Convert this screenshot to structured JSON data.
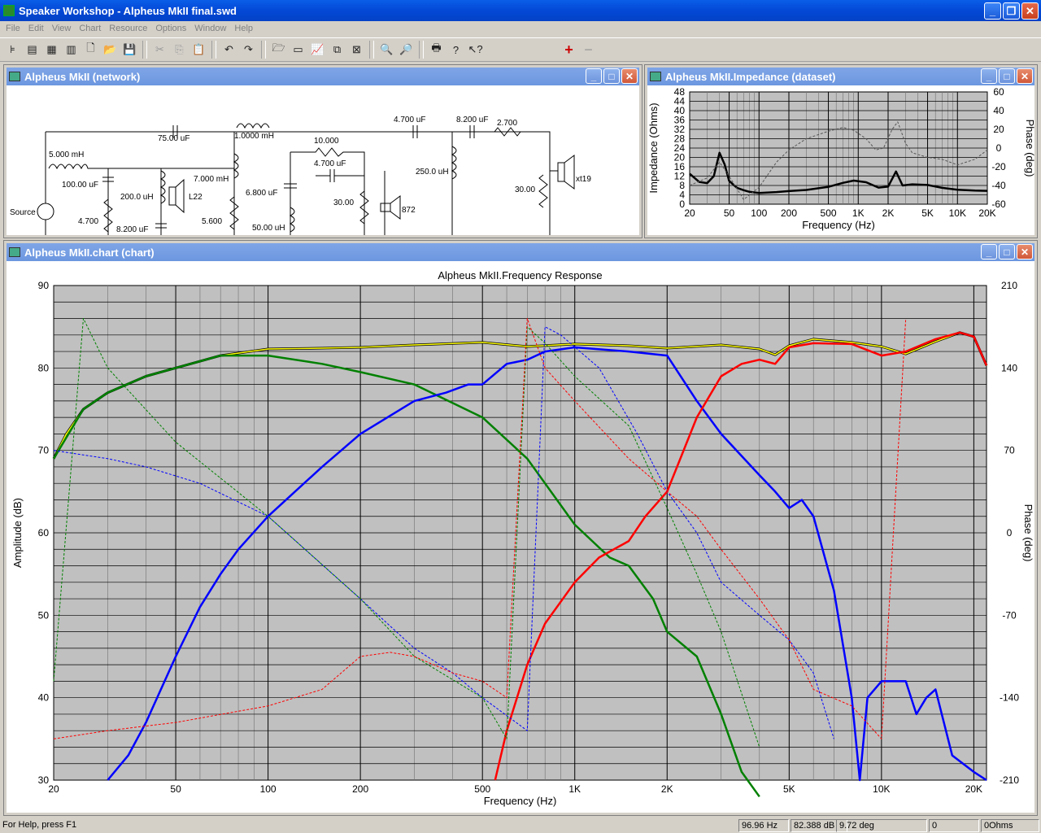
{
  "app": {
    "title": "Speaker Workshop - Alpheus MkII final.swd"
  },
  "menu": [
    "File",
    "Edit",
    "View",
    "Chart",
    "Resource",
    "Options",
    "Window",
    "Help"
  ],
  "network_window": {
    "title": "Alpheus MkII (network)",
    "labels": {
      "source": "Source",
      "l1": "5.000 mH",
      "c1": "100.00 uF",
      "r1": "4.700",
      "c2": "75.00 uF",
      "l2": "200.0 uH",
      "c3": "8.200 uF",
      "drv1": "L22",
      "l3": "1.0000 mH",
      "l4": "7.000 mH",
      "r2": "5.600",
      "r3": "10.000",
      "c4": "4.700 uF",
      "c5": "6.800 uF",
      "l5": "50.00 uH",
      "r4": "30.00",
      "drv2": "872",
      "c6": "4.700 uF",
      "c7": "8.200 uF",
      "r5": "2.700",
      "l6": "250.0 uH",
      "r6": "30.00",
      "drv3": "xt19"
    }
  },
  "impedance_window": {
    "title": "Alpheus MkII.Impedance (dataset)",
    "chart_data": {
      "type": "line",
      "xlabel": "Frequency (Hz)",
      "ylabel": "Impedance (Ohms)",
      "y2label": "Phase (deg)",
      "x_scale": "log",
      "xlim": [
        20,
        20000
      ],
      "ylim": [
        0,
        48
      ],
      "y2lim": [
        -60,
        60
      ],
      "x_ticks": [
        "20",
        "50",
        "100",
        "200",
        "500",
        "1K",
        "2K",
        "5K",
        "10K",
        "20K"
      ],
      "y_ticks": [
        "0",
        "4",
        "8",
        "12",
        "16",
        "20",
        "24",
        "28",
        "32",
        "36",
        "40",
        "44",
        "48"
      ],
      "y2_ticks": [
        "60",
        "40",
        "20",
        "0",
        "-20",
        "-40",
        "-60"
      ],
      "series": [
        {
          "axis": "left",
          "x": [
            20,
            25,
            30,
            35,
            40,
            45,
            50,
            60,
            70,
            80,
            100,
            150,
            200,
            300,
            500,
            700,
            900,
            1200,
            1600,
            2000,
            2400,
            2800,
            3500,
            5000,
            7000,
            10000,
            15000,
            20000
          ],
          "values": [
            13,
            9.5,
            9,
            12,
            22,
            17,
            10,
            7,
            6,
            5.3,
            4.8,
            5.2,
            5.6,
            6.1,
            7.4,
            9.1,
            10.1,
            9.4,
            7.1,
            7.5,
            14,
            8,
            8.5,
            8.2,
            7,
            6.2,
            5.8,
            5.7
          ]
        },
        {
          "axis": "right",
          "dashed": true,
          "x": [
            20,
            30,
            40,
            50,
            70,
            100,
            150,
            200,
            300,
            500,
            700,
            900,
            1200,
            1500,
            1800,
            2200,
            2500,
            3000,
            3500,
            5000,
            7000,
            10000,
            15000,
            20000
          ],
          "values": [
            -40,
            -32,
            -15,
            -30,
            -55,
            -42,
            -15,
            -2,
            10,
            18,
            22,
            19,
            10,
            -2,
            0,
            20,
            28,
            5,
            -5,
            -10,
            -12,
            -18,
            -12,
            -2
          ]
        }
      ]
    }
  },
  "chart_window": {
    "title": "Alpheus MkII.chart (chart)",
    "chart_data": {
      "type": "line",
      "title": "Alpheus MkII.Frequency Response",
      "xlabel": "Frequency (Hz)",
      "ylabel": "Amplitude (dB)",
      "y2label": "Phase (deg)",
      "x_scale": "log",
      "xlim": [
        20,
        22000
      ],
      "ylim": [
        30,
        90
      ],
      "y2lim": [
        -210,
        210
      ],
      "x_ticks": [
        "20",
        "50",
        "100",
        "200",
        "500",
        "1K",
        "2K",
        "5K",
        "10K",
        "20K"
      ],
      "y_ticks": [
        "90",
        "80",
        "70",
        "60",
        "50",
        "40",
        "30"
      ],
      "y2_ticks": [
        "210",
        "140",
        "70",
        "0",
        "-70",
        "-140",
        "-210"
      ],
      "series": [
        {
          "color": "#000000",
          "width": 3,
          "x": [
            20,
            22,
            25,
            30,
            40,
            50,
            70,
            100,
            150,
            200,
            300,
            500,
            700,
            1000,
            1500,
            2000,
            3000,
            4000,
            4500,
            5000,
            6000,
            8000,
            10000,
            12000,
            15000,
            18000,
            20000,
            22000
          ],
          "values": [
            69,
            72,
            75,
            77,
            79,
            80,
            81.5,
            82.3,
            82.4,
            82.5,
            82.8,
            83.1,
            82.6,
            82.9,
            82.7,
            82.4,
            82.8,
            82.3,
            81.6,
            82.7,
            83.5,
            83.1,
            82.6,
            81.7,
            83.2,
            84.3,
            83.8,
            80.3
          ]
        },
        {
          "color": "#ffff00",
          "width": 1.5,
          "x": [
            20,
            22,
            25,
            30,
            40,
            50,
            70,
            100,
            150,
            200,
            300,
            500,
            700,
            1000,
            1500,
            2000,
            3000,
            4000,
            4500,
            5000,
            6000,
            8000,
            10000,
            12000,
            15000,
            18000,
            20000,
            22000
          ],
          "values": [
            69,
            72,
            75,
            77,
            79,
            80,
            81.5,
            82.3,
            82.4,
            82.5,
            82.8,
            83.1,
            82.6,
            82.9,
            82.7,
            82.4,
            82.8,
            82.3,
            81.6,
            82.7,
            83.5,
            83.1,
            82.6,
            81.7,
            83.2,
            84.3,
            83.8,
            80.3
          ]
        },
        {
          "color": "#008000",
          "width": 2.5,
          "x": [
            20,
            25,
            30,
            40,
            50,
            70,
            100,
            150,
            200,
            300,
            500,
            700,
            1000,
            1300,
            1500,
            1800,
            2000,
            2500,
            3000,
            3500,
            4000
          ],
          "values": [
            69,
            75,
            77,
            79,
            80,
            81.5,
            81.5,
            80.5,
            79.5,
            78,
            74,
            69,
            61,
            57,
            56,
            52,
            48,
            45,
            38,
            31,
            28
          ]
        },
        {
          "color": "#0000ff",
          "width": 2.5,
          "x": [
            30,
            35,
            40,
            50,
            60,
            70,
            80,
            100,
            150,
            200,
            300,
            380,
            450,
            500,
            600,
            700,
            800,
            1000,
            1500,
            2000,
            2500,
            3000,
            4000,
            4500,
            5000,
            5500,
            6000,
            7000,
            8000,
            8500,
            9000,
            10000,
            11000,
            12000,
            13000,
            14000,
            15000,
            17000,
            20000,
            22000
          ],
          "values": [
            30,
            33,
            37,
            45,
            51,
            55,
            58,
            62,
            68,
            72,
            76,
            77,
            78,
            78,
            80.5,
            81,
            82,
            82.5,
            82,
            81.5,
            76,
            72,
            67,
            65,
            63,
            64,
            62,
            53,
            40,
            30,
            40,
            42,
            42,
            42,
            38,
            40,
            41,
            33,
            31,
            30
          ]
        },
        {
          "color": "#ff0000",
          "width": 2.5,
          "x": [
            550,
            600,
            700,
            800,
            1000,
            1200,
            1500,
            1700,
            2000,
            2500,
            3000,
            3500,
            4000,
            4500,
            5000,
            6000,
            8000,
            10000,
            12000,
            15000,
            18000,
            20000,
            22000
          ],
          "values": [
            30,
            36,
            44,
            49,
            54,
            57,
            59,
            62,
            65,
            74,
            79,
            80.5,
            81,
            80.5,
            82.5,
            83,
            82.9,
            81.5,
            82,
            83.5,
            84.3,
            83.8,
            80.3
          ]
        },
        {
          "color": "#0000ff",
          "dashed": true,
          "x": [
            20,
            30,
            40,
            60,
            100,
            200,
            300,
            400,
            500,
            700,
            800,
            900,
            1200,
            1600,
            2000,
            2500,
            3000,
            4000,
            5000,
            6000,
            7000
          ],
          "values": [
            70,
            69,
            68,
            66,
            62,
            52,
            46,
            43,
            40,
            36,
            85,
            84,
            80,
            72,
            65,
            60,
            54,
            50,
            47,
            43,
            35
          ]
        },
        {
          "color": "#008000",
          "dashed": true,
          "x": [
            20,
            25,
            30,
            50,
            100,
            200,
            300,
            500,
            600,
            700,
            800,
            1000,
            1500,
            2000,
            2500,
            3000,
            4000
          ],
          "values": [
            42,
            86,
            80,
            71,
            62,
            52,
            45,
            40,
            35,
            85,
            83,
            79,
            73,
            63,
            55,
            48,
            34
          ]
        },
        {
          "color": "#ff0000",
          "dashed": true,
          "x": [
            20,
            30,
            50,
            100,
            150,
            200,
            250,
            300,
            400,
            500,
            600,
            700,
            800,
            1000,
            1500,
            2000,
            2500,
            3000,
            4000,
            5000,
            6000,
            8000,
            10000,
            12000
          ],
          "values": [
            35,
            36,
            37,
            39,
            41,
            45,
            45.5,
            45,
            43,
            42,
            40,
            86,
            80,
            76,
            69,
            65,
            62,
            58,
            52,
            47,
            41,
            39,
            35,
            86
          ]
        }
      ]
    }
  },
  "status": {
    "help": "For Help, press F1",
    "freq": "96.96 Hz",
    "db": "82.388 dB",
    "deg": "9.72 deg",
    "val": "0",
    "ohms": "0Ohms"
  }
}
